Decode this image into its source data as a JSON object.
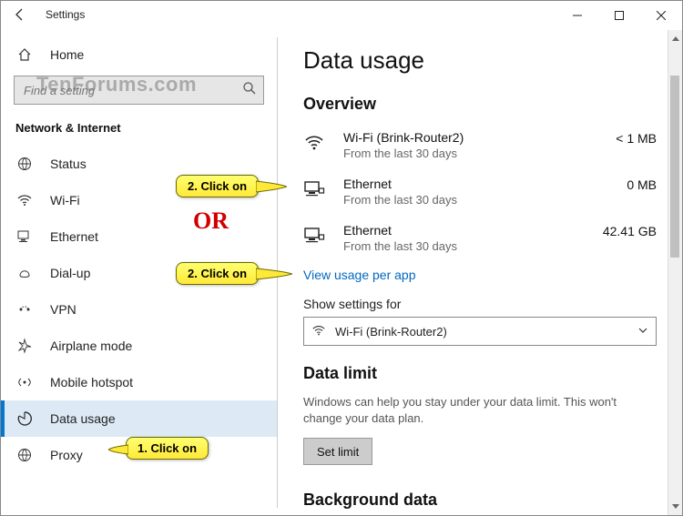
{
  "titlebar": {
    "app": "Settings"
  },
  "sidebar": {
    "home": "Home",
    "search_placeholder": "Find a setting",
    "category": "Network & Internet",
    "items": [
      {
        "label": "Status"
      },
      {
        "label": "Wi-Fi"
      },
      {
        "label": "Ethernet"
      },
      {
        "label": "Dial-up"
      },
      {
        "label": "VPN"
      },
      {
        "label": "Airplane mode"
      },
      {
        "label": "Mobile hotspot"
      },
      {
        "label": "Data usage"
      },
      {
        "label": "Proxy"
      }
    ]
  },
  "main": {
    "title": "Data usage",
    "overview_h": "Overview",
    "rows": [
      {
        "name": "Wi-Fi (Brink-Router2)",
        "sub": "From the last 30 days",
        "amt": "< 1 MB"
      },
      {
        "name": "Ethernet",
        "sub": "From the last 30 days",
        "amt": "0 MB"
      },
      {
        "name": "Ethernet",
        "sub": "From the last 30 days",
        "amt": "42.41 GB"
      }
    ],
    "view_link": "View usage per app",
    "show_for_label": "Show settings for",
    "dd_value": "Wi-Fi (Brink-Router2)",
    "limit_h": "Data limit",
    "limit_help": "Windows can help you stay under your data limit. This won't change your data plan.",
    "set_limit": "Set limit",
    "bg_h": "Background data"
  },
  "annot": {
    "c1": "1. Click on",
    "c2": "2. Click on",
    "c3": "2. Click on",
    "or": "OR",
    "watermark": "TenForums.com"
  }
}
